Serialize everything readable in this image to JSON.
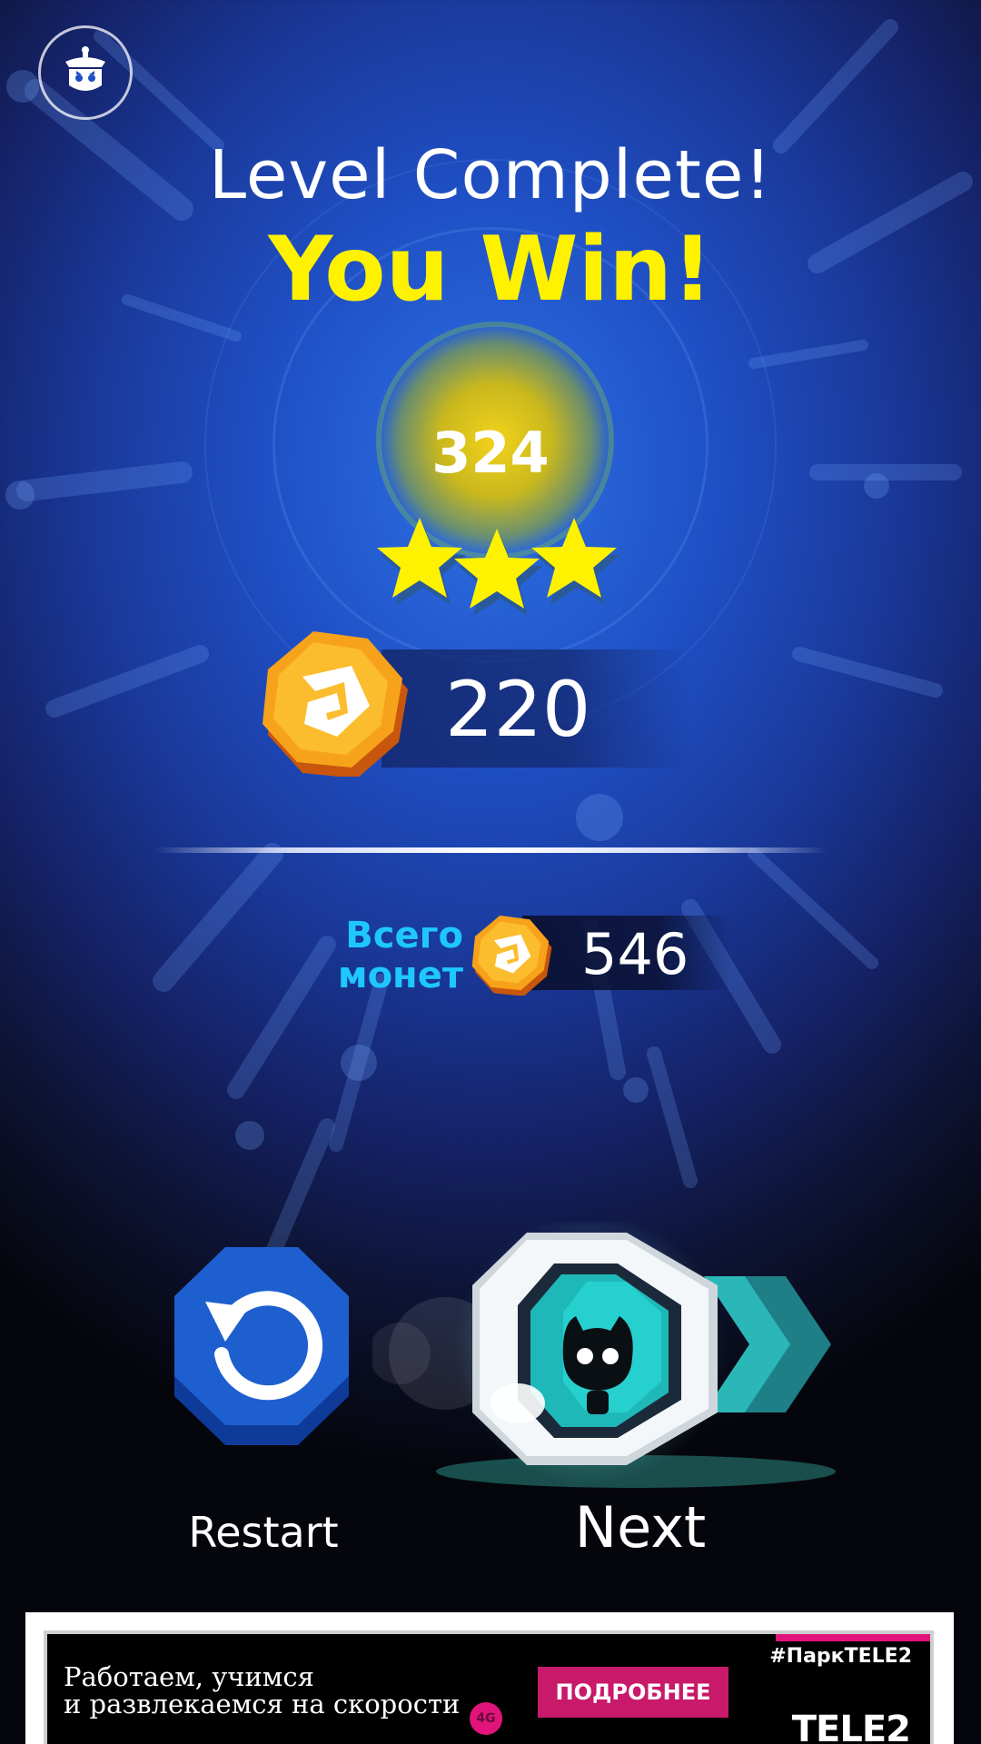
{
  "header": {
    "title": "Level Complete!",
    "subtitle": "You Win!"
  },
  "result": {
    "score": "324",
    "stars_earned": 3,
    "stars_total": 3,
    "coins_earned": "220"
  },
  "total_coins": {
    "label_line1": "Всего",
    "label_line2": "монет",
    "value": "546"
  },
  "actions": {
    "restart_label": "Restart",
    "next_label": "Next"
  },
  "ad": {
    "text_line1": "Работаем, учимся",
    "text_line2": "и развлекаемся на скорости",
    "badge": "4G",
    "cta": "ПОДРОБНЕЕ",
    "hashtag": "#ПаркTELE2",
    "logo": "TELE2"
  },
  "colors": {
    "title": "#ffffff",
    "win": "#fff200",
    "total_label": "#1ec8ff",
    "coin": "#f7a21b",
    "restart": "#1e5fd0",
    "next": "#22c6c6",
    "ad_accent": "#c8196b"
  },
  "icons": {
    "home": "robot-icon",
    "coin": "coin-icon",
    "star": "star-icon",
    "restart": "restart-arrow-icon",
    "next": "character-portal-icon"
  }
}
